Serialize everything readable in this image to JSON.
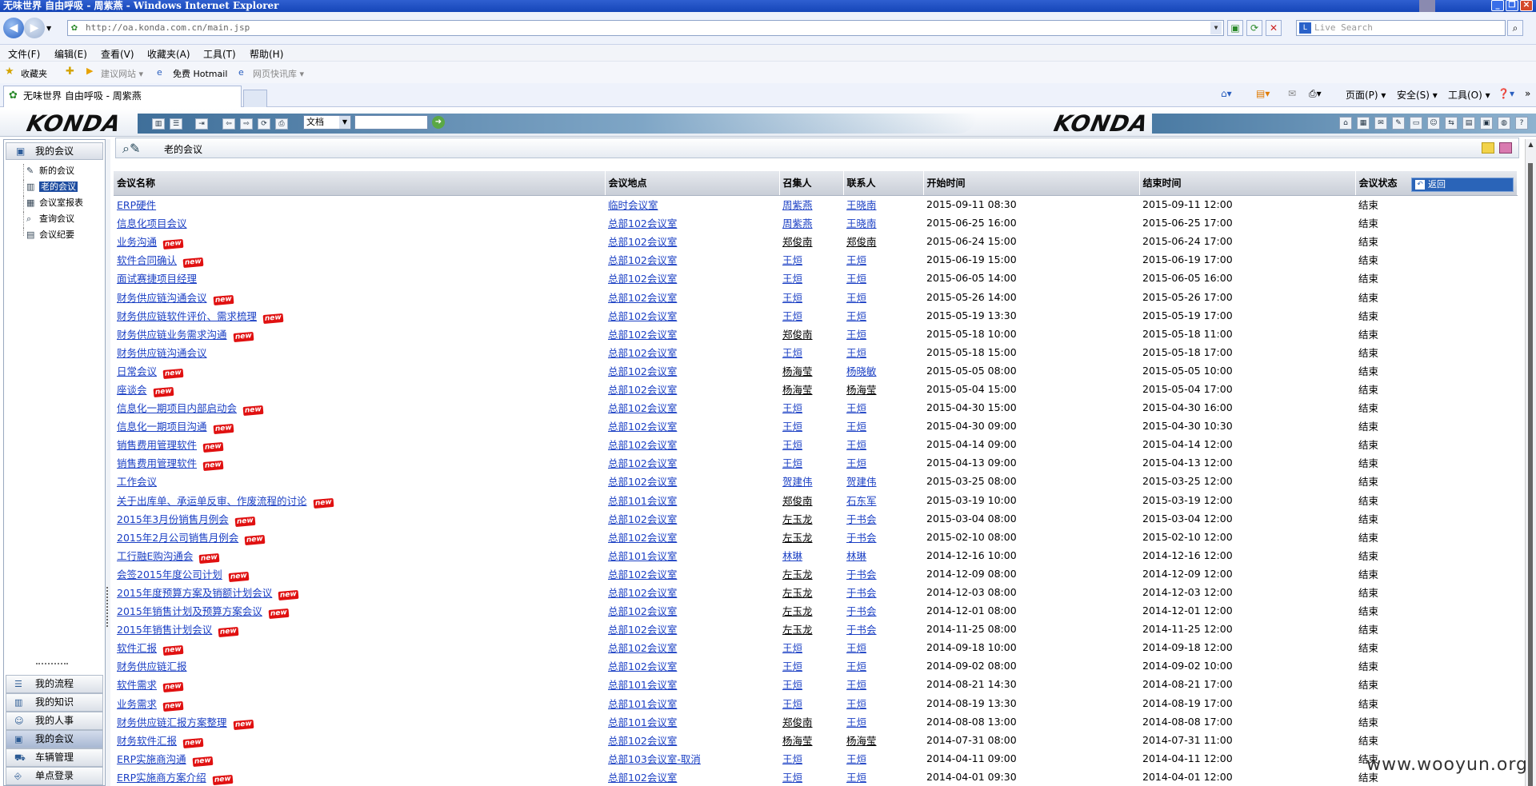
{
  "window": {
    "title": "无味世界 自由呼吸 - 周紫燕 - Windows Internet Explorer",
    "address": "http://oa.konda.com.cn/main.jsp",
    "live_search_placeholder": "Live Search"
  },
  "menu": [
    "文件(F)",
    "编辑(E)",
    "查看(V)",
    "收藏夹(A)",
    "工具(T)",
    "帮助(H)"
  ],
  "favorites": {
    "label": "收藏夹",
    "items": [
      "建议网站 ▾",
      "免费 Hotmail",
      "网页快讯库 ▾"
    ]
  },
  "tab": {
    "title": "无味世界 自由呼吸 - 周紫燕"
  },
  "command_bar": {
    "page": "页面(P) ▾",
    "safety": "安全(S) ▾",
    "tools": "工具(O) ▾"
  },
  "app": {
    "logo": "KONDA",
    "doc_combo": "文档"
  },
  "sidebar": {
    "header": "我的会议",
    "tree": [
      {
        "label": "新的会议",
        "selected": false
      },
      {
        "label": "老的会议",
        "selected": true
      },
      {
        "label": "会议室报表",
        "selected": false
      },
      {
        "label": "查询会议",
        "selected": false
      },
      {
        "label": "会议纪要",
        "selected": false
      }
    ],
    "bottom": [
      {
        "label": "我的流程",
        "active": false
      },
      {
        "label": "我的知识",
        "active": false
      },
      {
        "label": "我的人事",
        "active": false
      },
      {
        "label": "我的会议",
        "active": true
      },
      {
        "label": "车辆管理",
        "active": false
      },
      {
        "label": "单点登录",
        "active": false
      }
    ]
  },
  "main": {
    "crumb": "老的会议",
    "back_label": "返回",
    "columns": [
      "会议名称",
      "会议地点",
      "召集人",
      "联系人",
      "开始时间",
      "结束时间",
      "会议状态"
    ],
    "rows": [
      {
        "name": "ERP硬件",
        "new": false,
        "place": "临时会议室",
        "convener": "周紫燕",
        "convener_link": true,
        "contact": "王晓南",
        "contact_link": true,
        "start": "2015-09-11 08:30",
        "end": "2015-09-11 12:00",
        "status": "结束"
      },
      {
        "name": "信息化项目会议",
        "new": false,
        "place": "总部102会议室",
        "convener": "周紫燕",
        "convener_link": true,
        "contact": "王晓南",
        "contact_link": true,
        "start": "2015-06-25 16:00",
        "end": "2015-06-25 17:00",
        "status": "结束"
      },
      {
        "name": "业务沟通",
        "new": true,
        "place": "总部102会议室",
        "convener": "郑俊南",
        "convener_link": false,
        "contact": "郑俊南",
        "contact_link": false,
        "start": "2015-06-24 15:00",
        "end": "2015-06-24 17:00",
        "status": "结束"
      },
      {
        "name": "软件合同确认",
        "new": true,
        "place": "总部102会议室",
        "convener": "王烜",
        "convener_link": true,
        "contact": "王烜",
        "contact_link": true,
        "start": "2015-06-19 15:00",
        "end": "2015-06-19 17:00",
        "status": "结束"
      },
      {
        "name": "面试赛捷项目经理",
        "new": false,
        "place": "总部102会议室",
        "convener": "王烜",
        "convener_link": true,
        "contact": "王烜",
        "contact_link": true,
        "start": "2015-06-05 14:00",
        "end": "2015-06-05 16:00",
        "status": "结束"
      },
      {
        "name": "财务供应链沟通会议",
        "new": true,
        "place": "总部102会议室",
        "convener": "王烜",
        "convener_link": true,
        "contact": "王烜",
        "contact_link": true,
        "start": "2015-05-26 14:00",
        "end": "2015-05-26 17:00",
        "status": "结束"
      },
      {
        "name": "财务供应链软件评价、需求梳理",
        "new": true,
        "place": "总部102会议室",
        "convener": "王烜",
        "convener_link": true,
        "contact": "王烜",
        "contact_link": true,
        "start": "2015-05-19 13:30",
        "end": "2015-05-19 17:00",
        "status": "结束"
      },
      {
        "name": "财务供应链业务需求沟通",
        "new": true,
        "place": "总部102会议室",
        "convener": "郑俊南",
        "convener_link": false,
        "contact": "王烜",
        "contact_link": true,
        "start": "2015-05-18 10:00",
        "end": "2015-05-18 11:00",
        "status": "结束"
      },
      {
        "name": "财务供应链沟通会议",
        "new": false,
        "place": "总部102会议室",
        "convener": "王烜",
        "convener_link": true,
        "contact": "王烜",
        "contact_link": true,
        "start": "2015-05-18 15:00",
        "end": "2015-05-18 17:00",
        "status": "结束"
      },
      {
        "name": "日常会议",
        "new": true,
        "place": "总部102会议室",
        "convener": "杨海莹",
        "convener_link": false,
        "contact": "杨晓敏",
        "contact_link": true,
        "start": "2015-05-05 08:00",
        "end": "2015-05-05 10:00",
        "status": "结束"
      },
      {
        "name": "座谈会",
        "new": true,
        "place": "总部102会议室",
        "convener": "杨海莹",
        "convener_link": false,
        "contact": "杨海莹",
        "contact_link": false,
        "start": "2015-05-04 15:00",
        "end": "2015-05-04 17:00",
        "status": "结束"
      },
      {
        "name": "信息化一期项目内部启动会",
        "new": true,
        "place": "总部102会议室",
        "convener": "王烜",
        "convener_link": true,
        "contact": "王烜",
        "contact_link": true,
        "start": "2015-04-30 15:00",
        "end": "2015-04-30 16:00",
        "status": "结束"
      },
      {
        "name": "信息化一期项目沟通",
        "new": true,
        "place": "总部102会议室",
        "convener": "王烜",
        "convener_link": true,
        "contact": "王烜",
        "contact_link": true,
        "start": "2015-04-30 09:00",
        "end": "2015-04-30 10:30",
        "status": "结束"
      },
      {
        "name": "销售费用管理软件",
        "new": true,
        "place": "总部102会议室",
        "convener": "王烜",
        "convener_link": true,
        "contact": "王烜",
        "contact_link": true,
        "start": "2015-04-14 09:00",
        "end": "2015-04-14 12:00",
        "status": "结束"
      },
      {
        "name": "销售费用管理软件",
        "new": true,
        "place": "总部102会议室",
        "convener": "王烜",
        "convener_link": true,
        "contact": "王烜",
        "contact_link": true,
        "start": "2015-04-13 09:00",
        "end": "2015-04-13 12:00",
        "status": "结束"
      },
      {
        "name": "工作会议",
        "new": false,
        "place": "总部102会议室",
        "convener": "贺建伟",
        "convener_link": true,
        "contact": "贺建伟",
        "contact_link": true,
        "start": "2015-03-25 08:00",
        "end": "2015-03-25 12:00",
        "status": "结束"
      },
      {
        "name": "关于出库单、承运单反审、作废流程的讨论",
        "new": true,
        "place": "总部101会议室",
        "convener": "郑俊南",
        "convener_link": false,
        "contact": "石东军",
        "contact_link": true,
        "start": "2015-03-19 10:00",
        "end": "2015-03-19 12:00",
        "status": "结束"
      },
      {
        "name": "2015年3月份销售月例会",
        "new": true,
        "place": "总部102会议室",
        "convener": "左玉龙",
        "convener_link": false,
        "contact": "于书会",
        "contact_link": true,
        "start": "2015-03-04 08:00",
        "end": "2015-03-04 12:00",
        "status": "结束"
      },
      {
        "name": "2015年2月公司销售月例会",
        "new": true,
        "place": "总部102会议室",
        "convener": "左玉龙",
        "convener_link": false,
        "contact": "于书会",
        "contact_link": true,
        "start": "2015-02-10 08:00",
        "end": "2015-02-10 12:00",
        "status": "结束"
      },
      {
        "name": "工行融E购沟通会",
        "new": true,
        "place": "总部101会议室",
        "convener": "林琳",
        "convener_link": true,
        "contact": "林琳",
        "contact_link": true,
        "start": "2014-12-16 10:00",
        "end": "2014-12-16 12:00",
        "status": "结束"
      },
      {
        "name": "会签2015年度公司计划",
        "new": true,
        "place": "总部102会议室",
        "convener": "左玉龙",
        "convener_link": false,
        "contact": "于书会",
        "contact_link": true,
        "start": "2014-12-09 08:00",
        "end": "2014-12-09 12:00",
        "status": "结束"
      },
      {
        "name": "2015年度预算方案及销额计划会议",
        "new": true,
        "place": "总部102会议室",
        "convener": "左玉龙",
        "convener_link": false,
        "contact": "于书会",
        "contact_link": true,
        "start": "2014-12-03 08:00",
        "end": "2014-12-03 12:00",
        "status": "结束"
      },
      {
        "name": "2015年销售计划及预算方案会议",
        "new": true,
        "place": "总部102会议室",
        "convener": "左玉龙",
        "convener_link": false,
        "contact": "于书会",
        "contact_link": true,
        "start": "2014-12-01 08:00",
        "end": "2014-12-01 12:00",
        "status": "结束"
      },
      {
        "name": "2015年销售计划会议",
        "new": true,
        "place": "总部102会议室",
        "convener": "左玉龙",
        "convener_link": false,
        "contact": "于书会",
        "contact_link": true,
        "start": "2014-11-25 08:00",
        "end": "2014-11-25 12:00",
        "status": "结束"
      },
      {
        "name": "软件汇报",
        "new": true,
        "place": "总部102会议室",
        "convener": "王烜",
        "convener_link": true,
        "contact": "王烜",
        "contact_link": true,
        "start": "2014-09-18 10:00",
        "end": "2014-09-18 12:00",
        "status": "结束"
      },
      {
        "name": "财务供应链汇报",
        "new": false,
        "place": "总部102会议室",
        "convener": "王烜",
        "convener_link": true,
        "contact": "王烜",
        "contact_link": true,
        "start": "2014-09-02 08:00",
        "end": "2014-09-02 10:00",
        "status": "结束"
      },
      {
        "name": "软件需求",
        "new": true,
        "place": "总部101会议室",
        "convener": "王烜",
        "convener_link": true,
        "contact": "王烜",
        "contact_link": true,
        "start": "2014-08-21 14:30",
        "end": "2014-08-21 17:00",
        "status": "结束"
      },
      {
        "name": "业务需求",
        "new": true,
        "place": "总部101会议室",
        "convener": "王烜",
        "convener_link": true,
        "contact": "王烜",
        "contact_link": true,
        "start": "2014-08-19 13:30",
        "end": "2014-08-19 17:00",
        "status": "结束"
      },
      {
        "name": "财务供应链汇报方案整理",
        "new": true,
        "place": "总部101会议室",
        "convener": "郑俊南",
        "convener_link": false,
        "contact": "王烜",
        "contact_link": true,
        "start": "2014-08-08 13:00",
        "end": "2014-08-08 17:00",
        "status": "结束"
      },
      {
        "name": "财务软件汇报",
        "new": true,
        "place": "总部102会议室",
        "convener": "杨海莹",
        "convener_link": false,
        "contact": "杨海莹",
        "contact_link": false,
        "start": "2014-07-31 08:00",
        "end": "2014-07-31 11:00",
        "status": "结束"
      },
      {
        "name": "ERP实施商沟通",
        "new": true,
        "place": "总部103会议室-取消",
        "convener": "王烜",
        "convener_link": true,
        "contact": "王烜",
        "contact_link": true,
        "start": "2014-04-11 09:00",
        "end": "2014-04-11 12:00",
        "status": "结束"
      },
      {
        "name": "ERP实施商方案介绍",
        "new": true,
        "place": "总部102会议室",
        "convener": "王烜",
        "convener_link": true,
        "contact": "王烜",
        "contact_link": true,
        "start": "2014-04-01 09:30",
        "end": "2014-04-01 12:00",
        "status": "结束"
      }
    ]
  },
  "watermark": "www.wooyun.org"
}
